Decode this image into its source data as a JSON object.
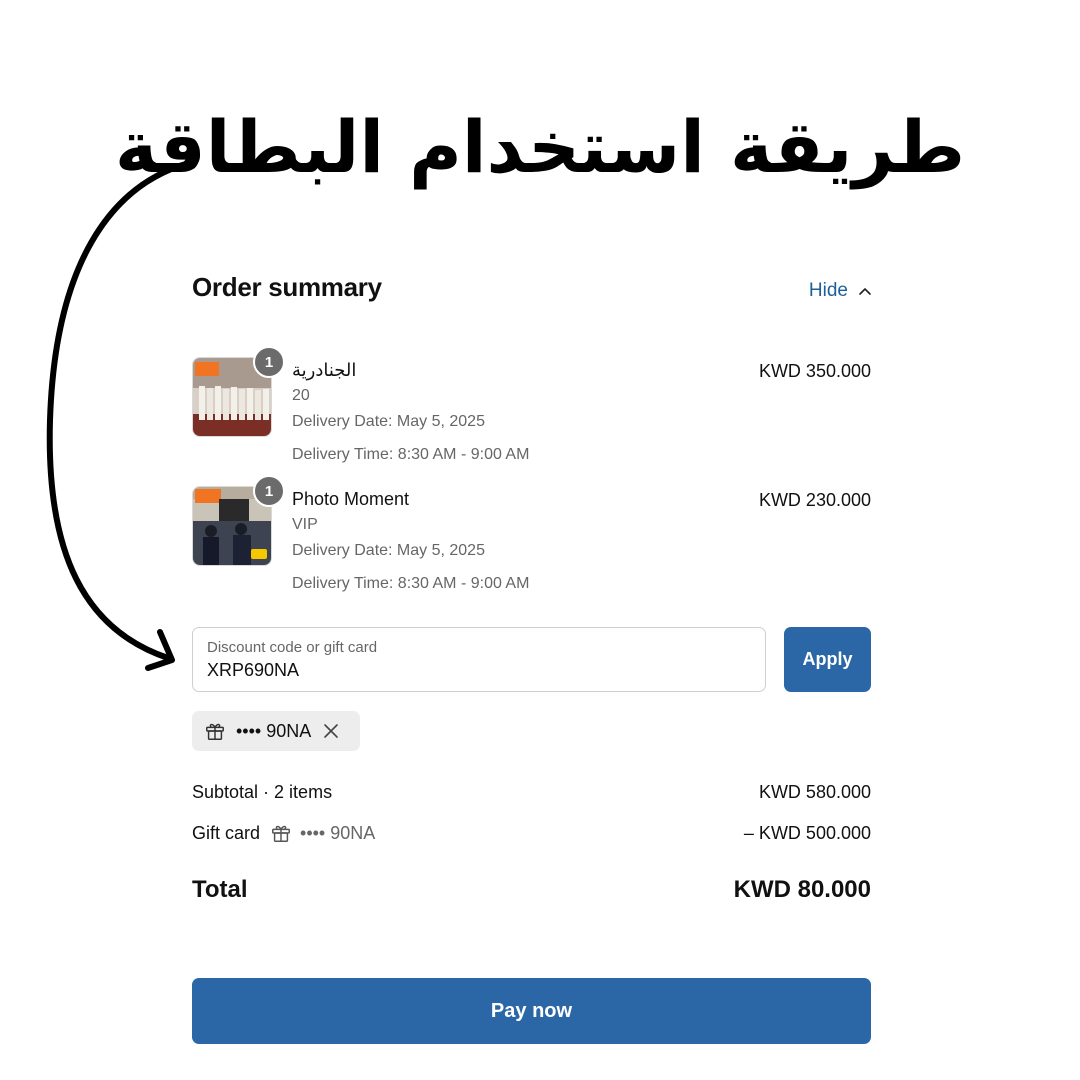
{
  "headline": "طريقة استخدام البطاقة",
  "order_summary": {
    "title": "Order summary",
    "toggle_label": "Hide",
    "toggle_icon": "chevron-up-icon"
  },
  "items": [
    {
      "name": "الجنادرية",
      "quantity": "1",
      "variant": "20",
      "delivery_date": "Delivery Date: May 5, 2025",
      "delivery_time": "Delivery Time: 8:30 AM - 9:00 AM",
      "price": "KWD 350.000"
    },
    {
      "name": "Photo Moment",
      "quantity": "1",
      "variant": "VIP",
      "delivery_date": "Delivery Date: May 5, 2025",
      "delivery_time": "Delivery Time: 8:30 AM - 9:00 AM",
      "price": "KWD 230.000"
    }
  ],
  "discount": {
    "placeholder": "Discount code or gift card",
    "value": "XRP690NA",
    "apply_label": "Apply"
  },
  "applied_gift_card": {
    "masked": "•••• 90NA",
    "icon": "gift-icon",
    "remove_icon": "close-icon"
  },
  "totals": {
    "subtotal_label": "Subtotal · 2 items",
    "subtotal_value": "KWD 580.000",
    "gift_card_label": "Gift card",
    "gift_card_masked": "•••• 90NA",
    "gift_card_value": "– KWD 500.000",
    "total_label": "Total",
    "total_value": "KWD 80.000"
  },
  "pay_label": "Pay now",
  "colors": {
    "accent": "#2b67a6",
    "link": "#1f5f99",
    "badge": "#6b6b6b",
    "chip_bg": "#ededed"
  }
}
